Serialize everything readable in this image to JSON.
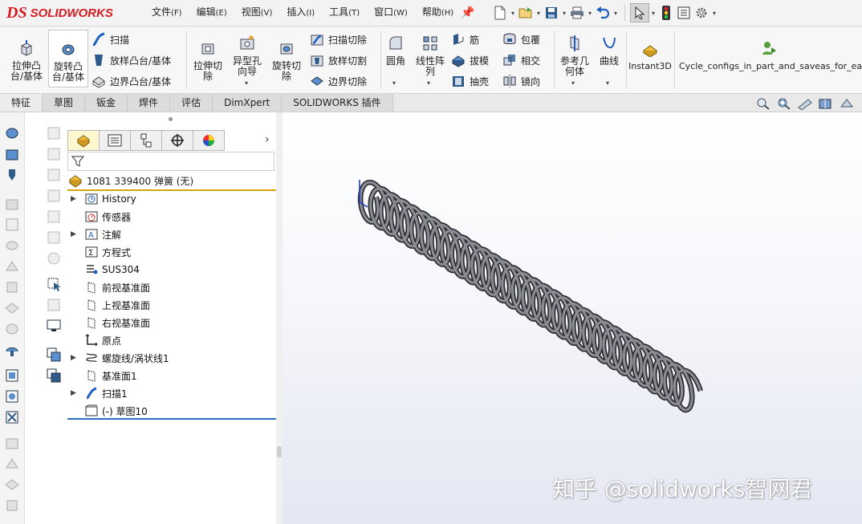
{
  "app": {
    "brand": "SOLIDWORKS",
    "ds_mark": "DS"
  },
  "menu": [
    {
      "label": "文件",
      "key": "(F)"
    },
    {
      "label": "编辑",
      "key": "(E)"
    },
    {
      "label": "视图",
      "key": "(V)"
    },
    {
      "label": "插入",
      "key": "(I)"
    },
    {
      "label": "工具",
      "key": "(T)"
    },
    {
      "label": "窗口",
      "key": "(W)"
    },
    {
      "label": "帮助",
      "key": "(H)"
    }
  ],
  "ribbon": {
    "extrude_boss": "拉伸凸\n台/基体",
    "revolve_boss": "旋转凸\n台/基体",
    "sweep": "扫描",
    "loft_boss": "放样凸台/基体",
    "boundary_boss": "边界凸台/基体",
    "extrude_cut": "拉伸切\n除",
    "hole_wizard": "异型孔\n向导",
    "revolve_cut": "旋转切\n除",
    "swept_cut": "扫描切除",
    "lofted_cut": "放样切割",
    "boundary_cut": "边界切除",
    "fillet": "圆角",
    "linear_pattern": "线性阵\n列",
    "rib": "筋",
    "draft": "拔模",
    "shell": "抽壳",
    "wrap": "包覆",
    "intersect": "相交",
    "mirror": "镜向",
    "ref_geometry": "参考几\n何体",
    "curves": "曲线",
    "instant3d": "Instant3D",
    "macro": "Cycle_configs_in_part_and_saveas_for_each"
  },
  "tabs": [
    "特征",
    "草图",
    "钣金",
    "焊件",
    "评估",
    "DimXpert",
    "SOLIDWORKS 插件"
  ],
  "tree": {
    "root": "1081 339400 弹簧  (无)",
    "items": [
      {
        "label": "History",
        "expandable": true,
        "icon": "history-icon"
      },
      {
        "label": "传感器",
        "expandable": false,
        "icon": "sensor-icon"
      },
      {
        "label": "注解",
        "expandable": true,
        "icon": "annotation-icon"
      },
      {
        "label": "方程式",
        "expandable": false,
        "icon": "equation-icon"
      },
      {
        "label": "SUS304",
        "expandable": false,
        "icon": "material-icon"
      },
      {
        "label": "前视基准面",
        "expandable": false,
        "icon": "plane-icon"
      },
      {
        "label": "上视基准面",
        "expandable": false,
        "icon": "plane-icon"
      },
      {
        "label": "右视基准面",
        "expandable": false,
        "icon": "plane-icon"
      },
      {
        "label": "原点",
        "expandable": false,
        "icon": "origin-icon"
      },
      {
        "label": "螺旋线/涡状线1",
        "expandable": true,
        "icon": "helix-icon"
      },
      {
        "label": "基准面1",
        "expandable": false,
        "icon": "plane-icon"
      },
      {
        "label": "扫描1",
        "expandable": true,
        "icon": "sweep-icon"
      },
      {
        "label": "(-) 草图10",
        "expandable": false,
        "icon": "sketch-icon"
      }
    ]
  },
  "watermark": "知乎 @solidworks智网君",
  "colors": {
    "brand_red": "#d71920",
    "accent_blue": "#2b6fc7",
    "root_underline": "#d9a400"
  }
}
